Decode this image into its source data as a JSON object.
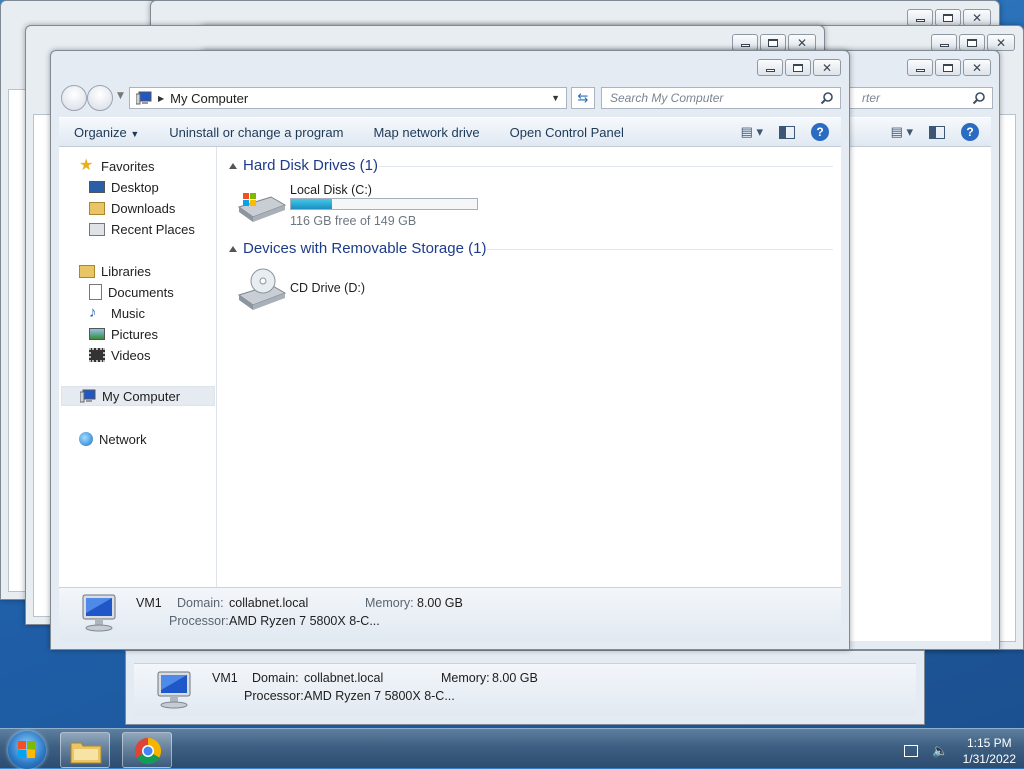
{
  "window": {
    "address_path": "My Computer",
    "search_placeholder": "Search My Computer"
  },
  "toolbar": {
    "organize": "Organize",
    "uninstall": "Uninstall or change a program",
    "map_drive": "Map network drive",
    "control_panel": "Open Control Panel"
  },
  "nav": {
    "favorites": "Favorites",
    "desktop": "Desktop",
    "downloads": "Downloads",
    "recent": "Recent Places",
    "libraries": "Libraries",
    "documents": "Documents",
    "music": "Music",
    "pictures": "Pictures",
    "videos": "Videos",
    "computer": "My Computer",
    "network": "Network"
  },
  "groups": {
    "hdd": "Hard Disk Drives (1)",
    "removable": "Devices with Removable Storage (1)"
  },
  "drives": {
    "c_name": "Local Disk (C:)",
    "c_free": "116 GB free of 149 GB",
    "c_used_fraction": 0.22,
    "d_name": "CD Drive (D:)"
  },
  "details": {
    "name": "VM1",
    "domain_label": "Domain:",
    "domain": "collabnet.local",
    "memory_label": "Memory:",
    "memory": "8.00 GB",
    "processor_label": "Processor:",
    "processor": "AMD Ryzen 7 5800X 8-C..."
  },
  "behind_search_fragment": "rter",
  "taskbar": {
    "time": "1:15 PM",
    "date": "1/31/2022"
  }
}
